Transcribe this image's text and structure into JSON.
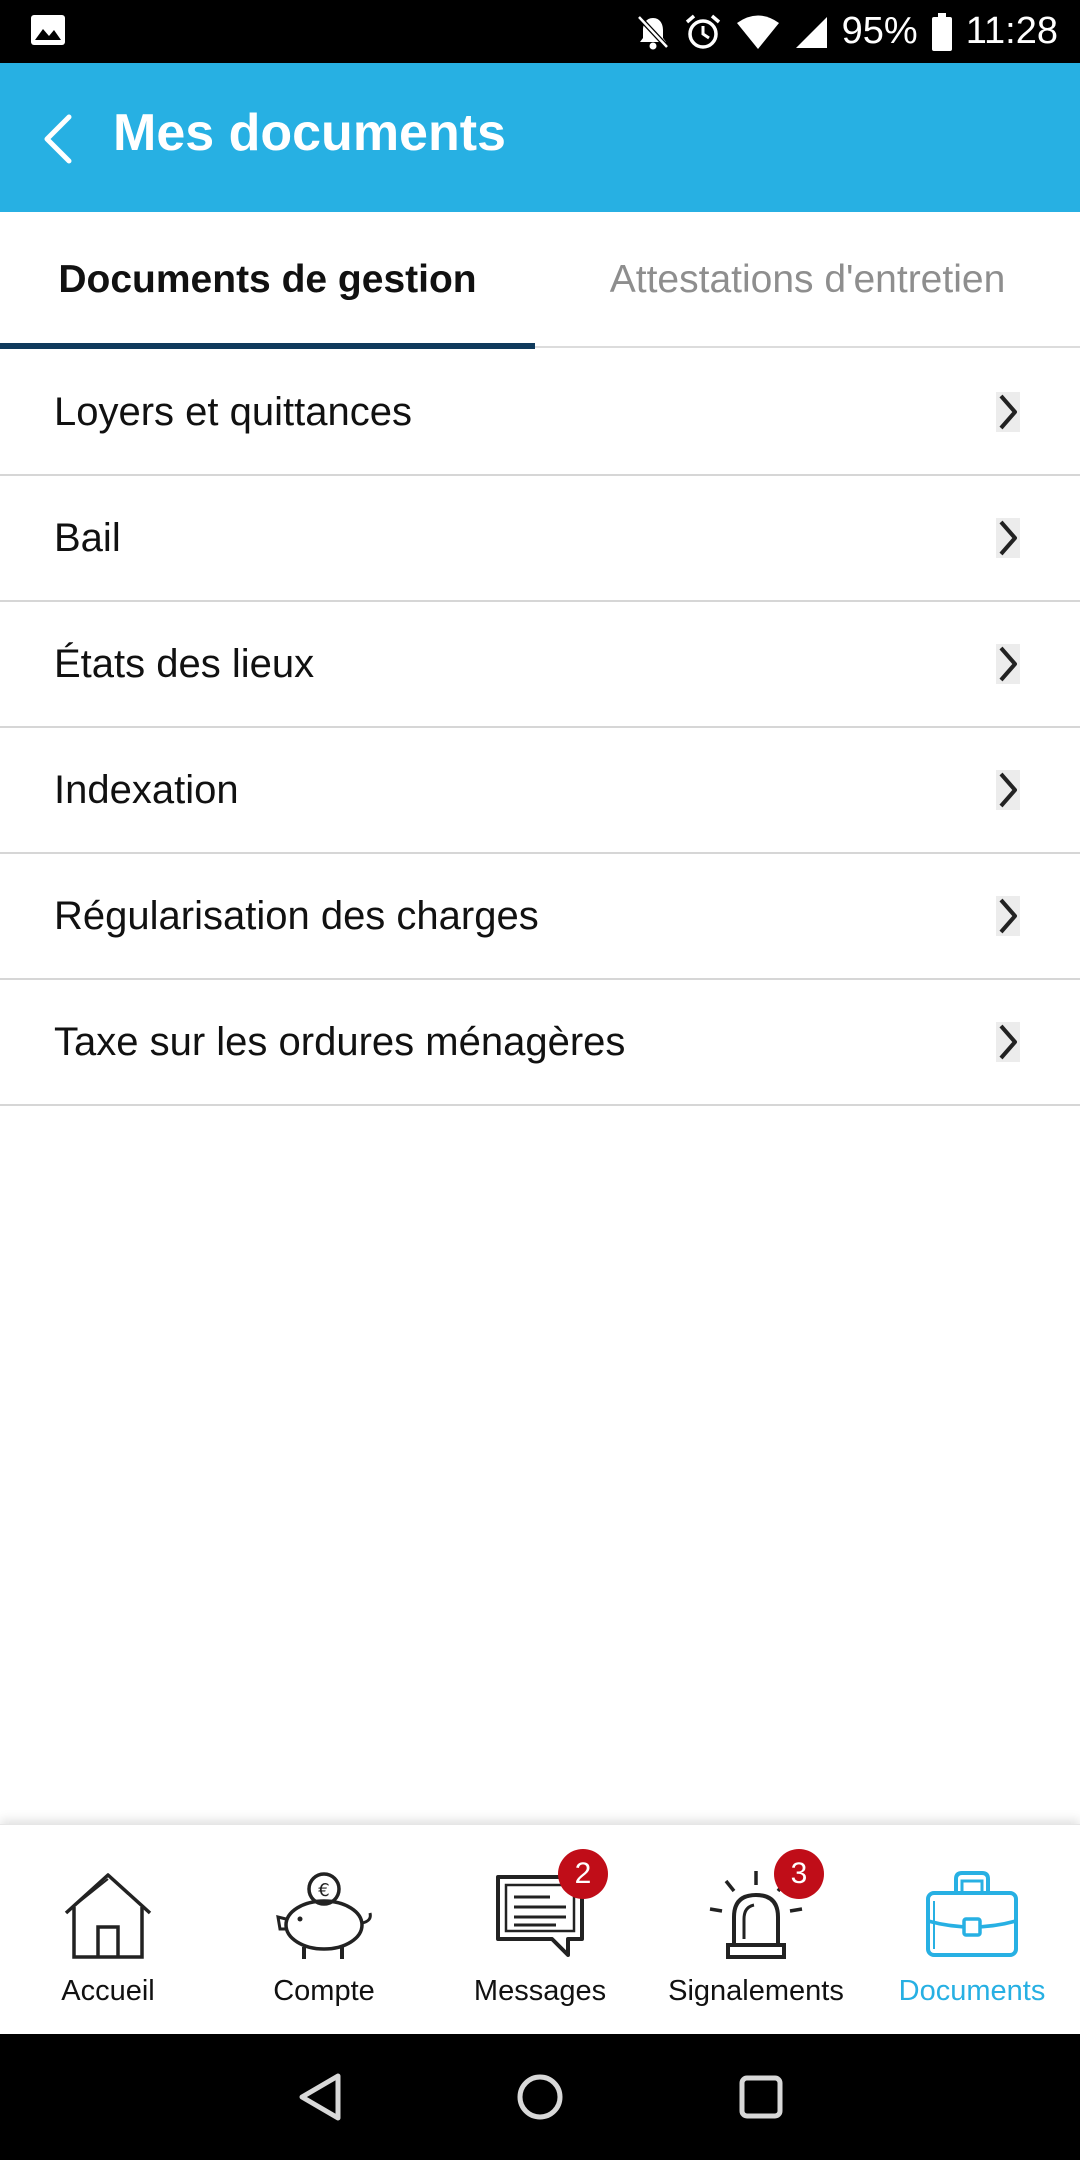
{
  "status_bar": {
    "battery": "95%",
    "time": "11:28",
    "icons": [
      "image-notification-icon",
      "bell-off-icon",
      "alarm-icon",
      "wifi-icon",
      "signal-icon",
      "battery-icon"
    ]
  },
  "app_bar": {
    "title": "Mes documents",
    "background_color": "#27b0e3"
  },
  "tabs": [
    {
      "label": "Documents de gestion",
      "active": true
    },
    {
      "label": "Attestations d'entretien",
      "active": false
    }
  ],
  "documents": [
    {
      "label": "Loyers et quittances"
    },
    {
      "label": "Bail"
    },
    {
      "label": "États des lieux"
    },
    {
      "label": "Indexation"
    },
    {
      "label": "Régularisation des charges"
    },
    {
      "label": "Taxe sur les ordures ménagères"
    }
  ],
  "bottom_nav": [
    {
      "label": "Accueil",
      "icon": "house-icon",
      "active": false
    },
    {
      "label": "Compte",
      "icon": "piggy-bank-icon",
      "active": false
    },
    {
      "label": "Messages",
      "icon": "messages-icon",
      "badge": "2",
      "active": false
    },
    {
      "label": "Signalements",
      "icon": "alarm-siren-icon",
      "badge": "3",
      "active": false
    },
    {
      "label": "Documents",
      "icon": "briefcase-icon",
      "active": true
    }
  ],
  "colors": {
    "accent": "#27b0e3",
    "tab_indicator": "#0f3a5c",
    "badge": "#c00d18"
  }
}
